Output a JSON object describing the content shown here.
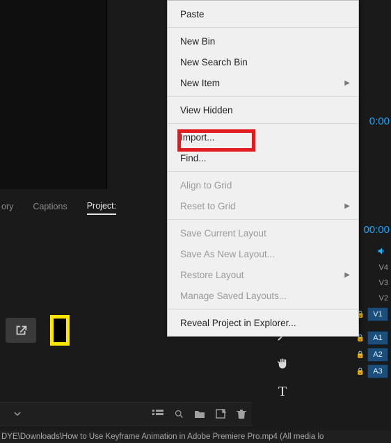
{
  "tabs": {
    "history": "ory",
    "captions": "Captions",
    "project": "Project:"
  },
  "context_menu": {
    "paste": "Paste",
    "new_bin": "New Bin",
    "new_search_bin": "New Search Bin",
    "new_item": "New Item",
    "view_hidden": "View Hidden",
    "import": "Import...",
    "find": "Find...",
    "align_to_grid": "Align to Grid",
    "reset_to_grid": "Reset to Grid",
    "save_current_layout": "Save Current Layout",
    "save_as_new_layout": "Save As New Layout...",
    "restore_layout": "Restore Layout",
    "manage_saved_layouts": "Manage Saved Layouts...",
    "reveal_in_explorer": "Reveal Project in Explorer..."
  },
  "timeline": {
    "timecode1": "0:00",
    "timecode2": "00:00",
    "tracks": {
      "v4": "V4",
      "v3": "V3",
      "v2": "V2",
      "v1": "V1",
      "a1": "A1",
      "a2": "A2",
      "a3": "A3"
    }
  },
  "status": "DYE\\Downloads\\How to Use Keyframe Animation in Adobe Premiere Pro.mp4 (All media lo"
}
